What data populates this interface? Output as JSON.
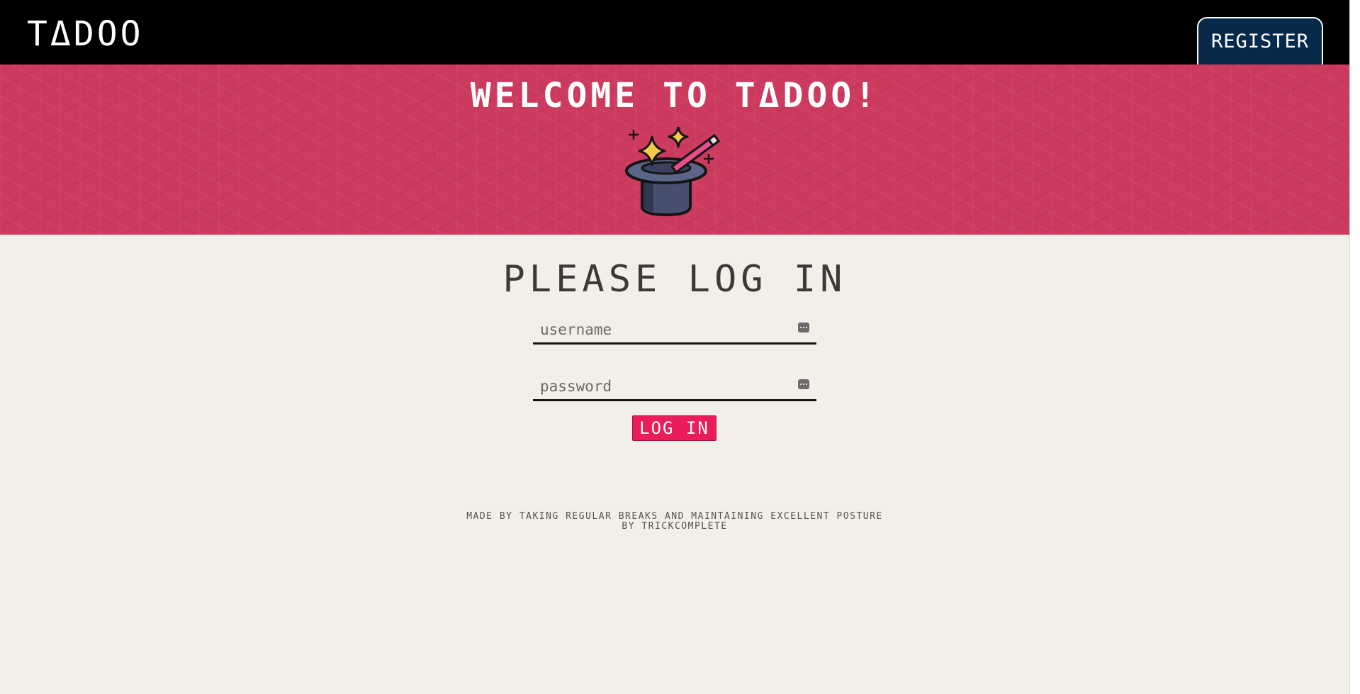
{
  "header": {
    "logo": "TΔDOO",
    "register_label": "REGISTER"
  },
  "banner": {
    "welcome": "WELCOME TO TΔDOO!",
    "image_icon": "magic-hat-icon"
  },
  "login": {
    "title": "PLEASE LOG IN",
    "username": {
      "placeholder": "username",
      "value": ""
    },
    "password": {
      "placeholder": "password",
      "value": ""
    },
    "field_icon": "password-manager-key-icon",
    "submit_label": "LOG IN"
  },
  "footer": {
    "line1": "MADE BY TAKING REGULAR BREAKS AND MAINTAINING EXCELLENT POSTURE",
    "line2": "BY TRICKCOMPLETE"
  },
  "colors": {
    "topbar": "#000000",
    "banner": "#cc3a5e",
    "register_bg": "#072a4a",
    "login_button": "#ea1d5a",
    "page_bg": "#f2efe8"
  }
}
